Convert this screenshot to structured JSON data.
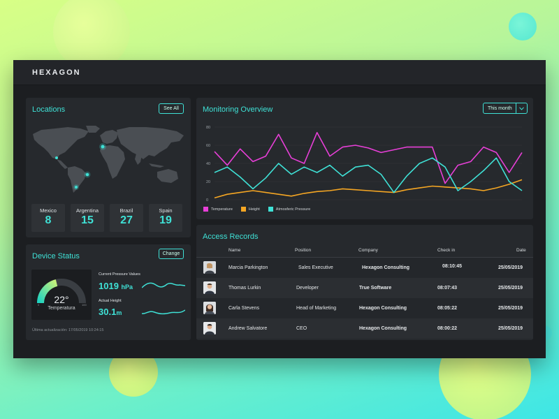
{
  "app": {
    "brand": "HEXAGON"
  },
  "locations": {
    "title": "Locations",
    "button": "See All",
    "stats": [
      {
        "label": "Mexico",
        "value": "8"
      },
      {
        "label": "Argentina",
        "value": "15"
      },
      {
        "label": "Brazil",
        "value": "27"
      },
      {
        "label": "Spain",
        "value": "19"
      }
    ]
  },
  "device": {
    "title": "Device Status",
    "button": "Change",
    "gauge": {
      "value": "22°",
      "label": "Temperatura",
      "min": "0",
      "max": "100"
    },
    "pressure_label": "Current Pressure Values",
    "pressure_value": "1019",
    "pressure_unit": "hPa",
    "height_label": "Actual Height",
    "height_value": "30.1",
    "height_unit": "m",
    "updated": "Última actualización: 17/05/2019 10:24:15"
  },
  "monitoring": {
    "title": "Monitoring Overview",
    "select": "This month",
    "legend": [
      "Temperature",
      "Height",
      "Atmosferic Pressure"
    ]
  },
  "chart_data": {
    "type": "line",
    "x": [
      1,
      2,
      3,
      4,
      5,
      6,
      7,
      8,
      9,
      10,
      11,
      12,
      13,
      14,
      15,
      16,
      17,
      18,
      19,
      20,
      21,
      22,
      23,
      24,
      25
    ],
    "ylim": [
      0,
      80
    ],
    "yticks": [
      "0",
      "20",
      "40",
      "60",
      "80"
    ],
    "grid": true,
    "legend_placement": "bottom-left",
    "series": [
      {
        "name": "Temperature",
        "color": "#e83fd8",
        "values": [
          53,
          38,
          56,
          42,
          48,
          72,
          46,
          40,
          74,
          48,
          58,
          60,
          57,
          52,
          55,
          58,
          58,
          58,
          18,
          38,
          42,
          58,
          52,
          30,
          52
        ]
      },
      {
        "name": "Height",
        "color": "#f5a623",
        "values": [
          2,
          6,
          8,
          10,
          8,
          6,
          4,
          7,
          9,
          10,
          12,
          11,
          10,
          9,
          8,
          11,
          13,
          15,
          14,
          13,
          12,
          10,
          13,
          17,
          22
        ]
      },
      {
        "name": "Atmosferic Pressure",
        "color": "#3fe1d6",
        "values": [
          30,
          36,
          25,
          12,
          24,
          40,
          28,
          36,
          30,
          38,
          26,
          36,
          38,
          28,
          8,
          26,
          40,
          46,
          36,
          10,
          20,
          32,
          46,
          20,
          10
        ]
      }
    ]
  },
  "access": {
    "title": "Access Records",
    "headers": {
      "name": "Name",
      "position": "Position",
      "company": "Company",
      "checkin": "Check in",
      "date": "Date"
    },
    "rows": [
      {
        "name": "Marcia Parkington",
        "position": "Sales Executive",
        "company": "Hexagon Consulting",
        "checkin": "08:10:45",
        "date": "25/05/2019"
      },
      {
        "name": "Thomas Lurkin",
        "position": "Developer",
        "company": "True Software",
        "checkin": "08:07:43",
        "date": "25/05/2019"
      },
      {
        "name": "Carla Stevens",
        "position": "Head of Marketing",
        "company": "Hexagon Consulting",
        "checkin": "08:05:22",
        "date": "25/05/2019"
      },
      {
        "name": "Andrew Salvatore",
        "position": "CEO",
        "company": "Hexagon Consulting",
        "checkin": "08:00:22",
        "date": "25/05/2019"
      }
    ]
  }
}
